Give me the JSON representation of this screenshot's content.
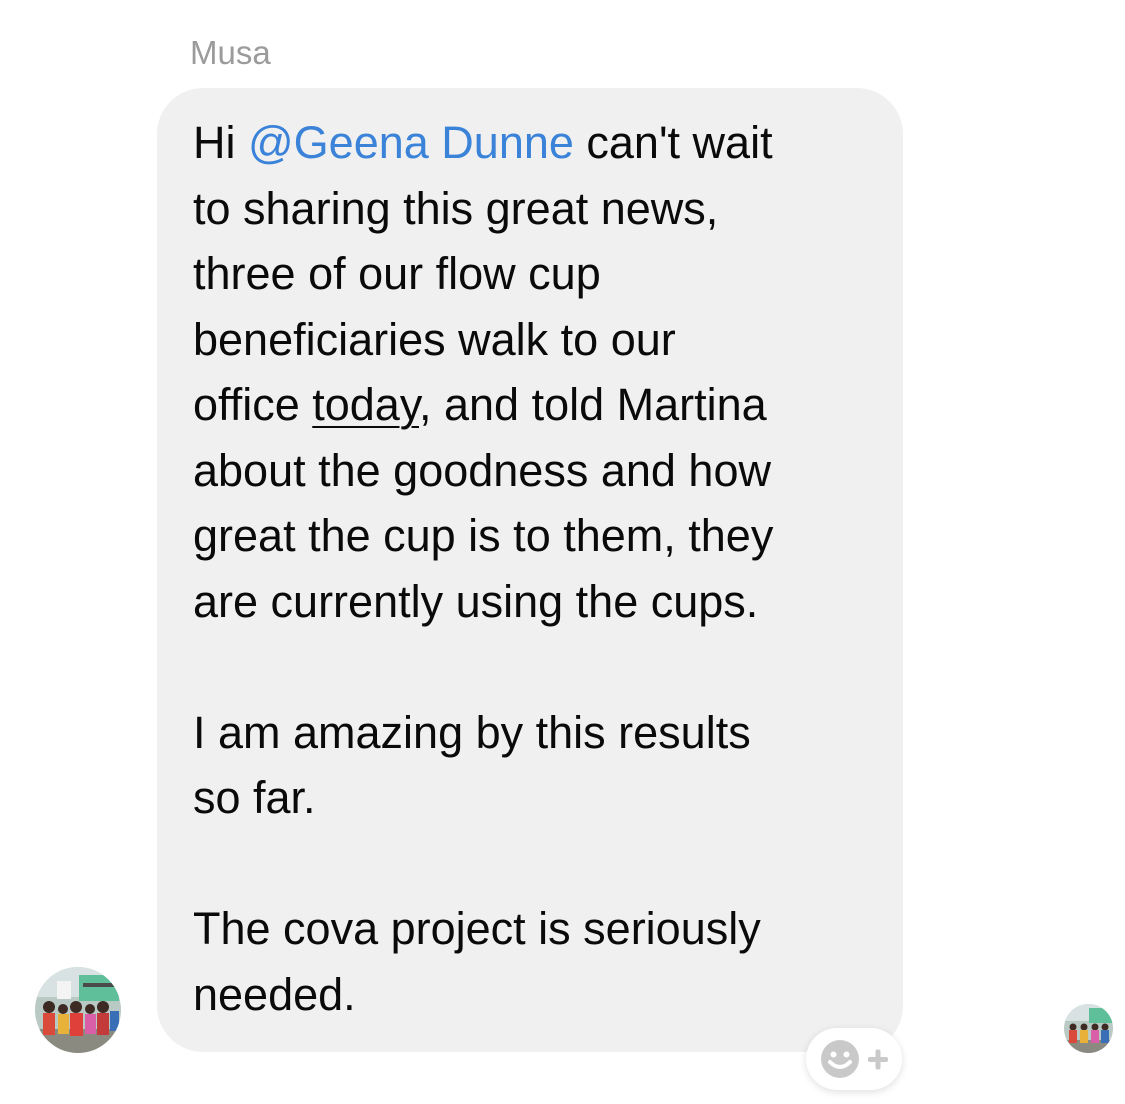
{
  "message": {
    "sender": "Musa",
    "paragraph1": {
      "before_mention": "Hi ",
      "mention": "@Geena Dunne",
      "after_mention": " can't wait\nto sharing this great news,\nthree of our flow cup\nbeneficiaries walk to our\noffice ",
      "underlined": "today",
      "after_underlined": ", and told Martina\nabout the goodness and how\ngreat the cup is to them, they\nare currently using the cups."
    },
    "paragraph2": "I am amazing by this results\nso far.",
    "paragraph3": "The cova project is seriously\nneeded."
  },
  "colors": {
    "bubble_background": "#f0f0f0",
    "mention": "#3b83d9",
    "sender_name": "#9b9b9b"
  },
  "icons": {
    "reaction": "add-reaction-icon",
    "sender_avatar": "avatar-photo",
    "read_receipt": "read-receipt-avatar"
  }
}
